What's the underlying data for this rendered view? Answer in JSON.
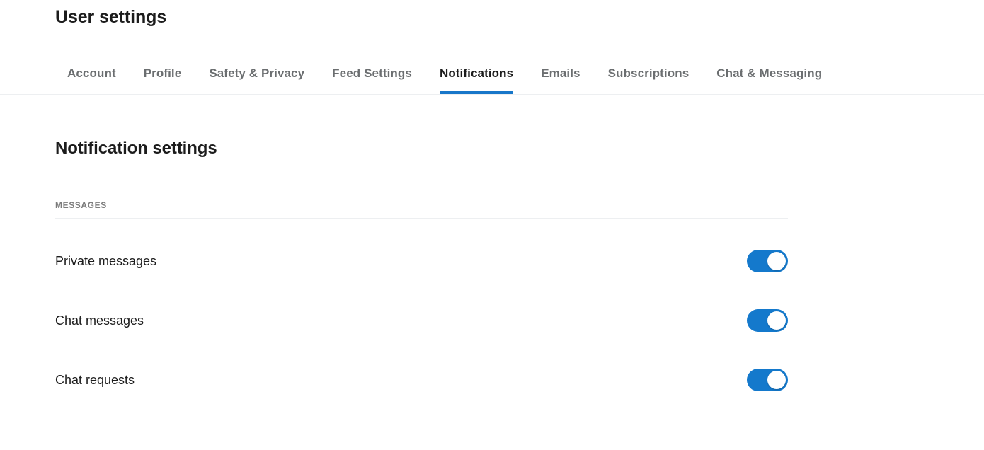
{
  "header": {
    "title": "User settings"
  },
  "tabs": [
    {
      "label": "Account",
      "active": false,
      "name": "tab-account"
    },
    {
      "label": "Profile",
      "active": false,
      "name": "tab-profile"
    },
    {
      "label": "Safety & Privacy",
      "active": false,
      "name": "tab-safety-privacy"
    },
    {
      "label": "Feed Settings",
      "active": false,
      "name": "tab-feed-settings"
    },
    {
      "label": "Notifications",
      "active": true,
      "name": "tab-notifications"
    },
    {
      "label": "Emails",
      "active": false,
      "name": "tab-emails"
    },
    {
      "label": "Subscriptions",
      "active": false,
      "name": "tab-subscriptions"
    },
    {
      "label": "Chat & Messaging",
      "active": false,
      "name": "tab-chat-messaging"
    }
  ],
  "main": {
    "section_title": "Notification settings",
    "groups": [
      {
        "label": "MESSAGES",
        "rows": [
          {
            "label": "Private messages",
            "toggle_state": "on",
            "name": "row-private-messages"
          },
          {
            "label": "Chat messages",
            "toggle_state": "on",
            "name": "row-chat-messages"
          },
          {
            "label": "Chat requests",
            "toggle_state": "on",
            "name": "row-chat-requests"
          }
        ]
      }
    ]
  },
  "colors": {
    "accent": "#1877c9",
    "toggle_on": "#1479cc",
    "toggle_off": "#c8cbcd",
    "text_primary": "#1c1c1c",
    "text_muted": "#6b6e70",
    "group_label": "#7c7c7c",
    "divider": "#edeff1",
    "background": "#ffffff"
  }
}
